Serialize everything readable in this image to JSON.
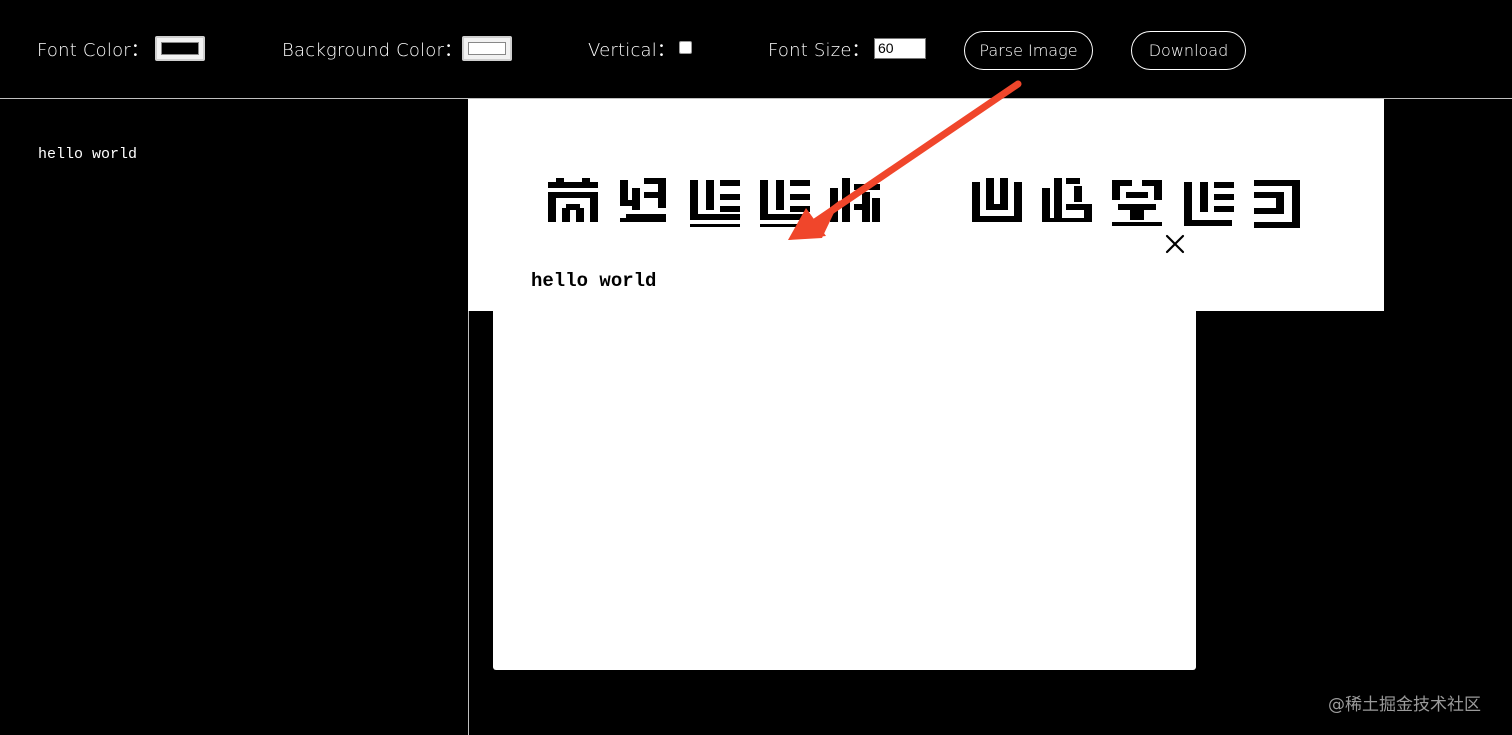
{
  "toolbar": {
    "font_color_label": "Font Color：",
    "background_color_label": "Background Color：",
    "vertical_label": "Vertical：",
    "font_size_label": "Font Size：",
    "font_size_value": "60",
    "parse_image_label": "Parse Image",
    "download_label": "Download",
    "font_color_value": "#000000",
    "background_color_value": "#ffffff",
    "vertical_checked": false
  },
  "editor": {
    "text": "hello world"
  },
  "preview": {
    "text": "hello world",
    "close_icon": "close-icon"
  },
  "annotation": {
    "arrow_color": "#f0462b"
  },
  "watermark": {
    "text": "@稀土掘金技术社区"
  }
}
